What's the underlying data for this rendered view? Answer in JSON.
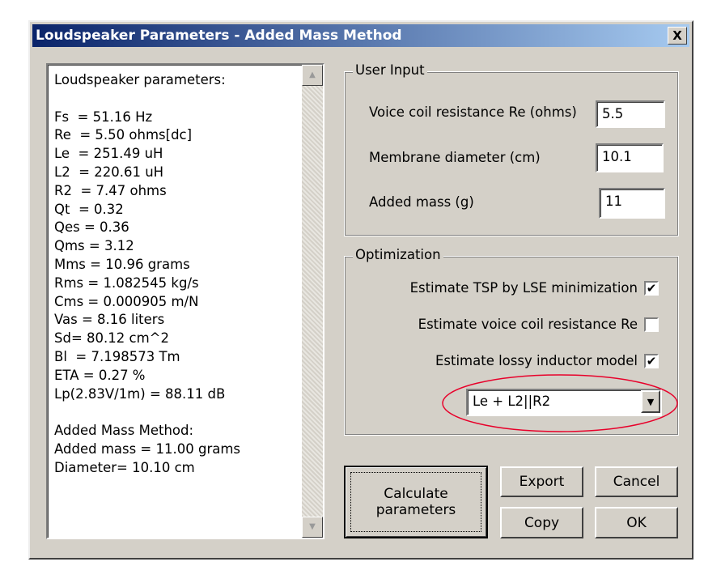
{
  "window": {
    "title": "Loudspeaker Parameters - Added Mass Method",
    "close": "X"
  },
  "results": {
    "lines": [
      "Loudspeaker parameters:",
      "",
      "Fs  = 51.16 Hz",
      "Re  = 5.50 ohms[dc]",
      "Le  = 251.49 uH",
      "L2  = 220.61 uH",
      "R2  = 7.47 ohms",
      "Qt  = 0.32",
      "Qes = 0.36",
      "Qms = 3.12",
      "Mms = 10.96 grams",
      "Rms = 1.082545 kg/s",
      "Cms = 0.000905 m/N",
      "Vas = 8.16 liters",
      "Sd= 80.12 cm^2",
      "Bl  = 7.198573 Tm",
      "ETA = 0.27 %",
      "Lp(2.83V/1m) = 88.11 dB",
      "",
      "Added Mass Method:",
      "Added mass = 11.00 grams",
      "Diameter= 10.10 cm"
    ]
  },
  "user_input": {
    "title": "User Input",
    "re_label": "Voice coil resistance Re (ohms)",
    "re_value": "5.5",
    "diam_label": "Membrane diameter (cm)",
    "diam_value": "10.1",
    "mass_label": "Added mass (g)",
    "mass_value": "11"
  },
  "optimization": {
    "title": "Optimization",
    "lse_label": "Estimate TSP by LSE minimization",
    "lse_checked": true,
    "re_label": "Estimate voice coil resistance Re",
    "re_checked": false,
    "lossy_label": "Estimate lossy inductor model",
    "lossy_checked": true,
    "model": "Le + L2||R2",
    "check_mark": "✔"
  },
  "buttons": {
    "calculate": "Calculate parameters",
    "export": "Export",
    "cancel": "Cancel",
    "copy": "Copy",
    "ok": "OK"
  },
  "annotation_color": "#e8002a"
}
